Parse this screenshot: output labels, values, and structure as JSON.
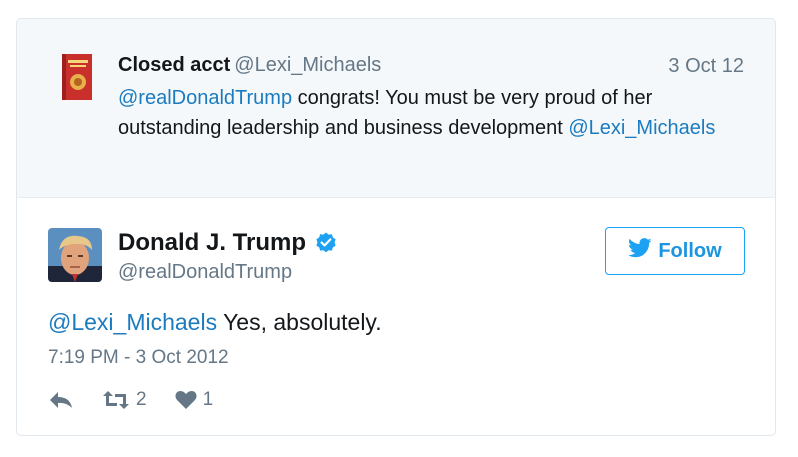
{
  "parent_tweet": {
    "display_name": "Closed acct",
    "handle": "@Lexi_Michaels",
    "date": "3 Oct 12",
    "mention_start": "@realDonaldTrump",
    "body": " congrats! You must be very proud of her outstanding leadership and business development ",
    "mention_end": "@Lexi_Michaels",
    "avatar_icon": "book-cover-icon"
  },
  "tweet": {
    "display_name": "Donald J. Trump",
    "handle": "@realDonaldTrump",
    "verified_icon": "verified-badge-icon",
    "follow_label": "Follow",
    "mention": "@Lexi_Michaels",
    "body": " Yes, absolutely.",
    "timestamp": "7:19 PM - 3 Oct 2012",
    "retweet_count": "2",
    "like_count": "1"
  },
  "colors": {
    "link": "#1b7bbf",
    "follow_accent": "#1da1f2",
    "muted": "#657786",
    "parent_bg": "#f5f8fa"
  }
}
